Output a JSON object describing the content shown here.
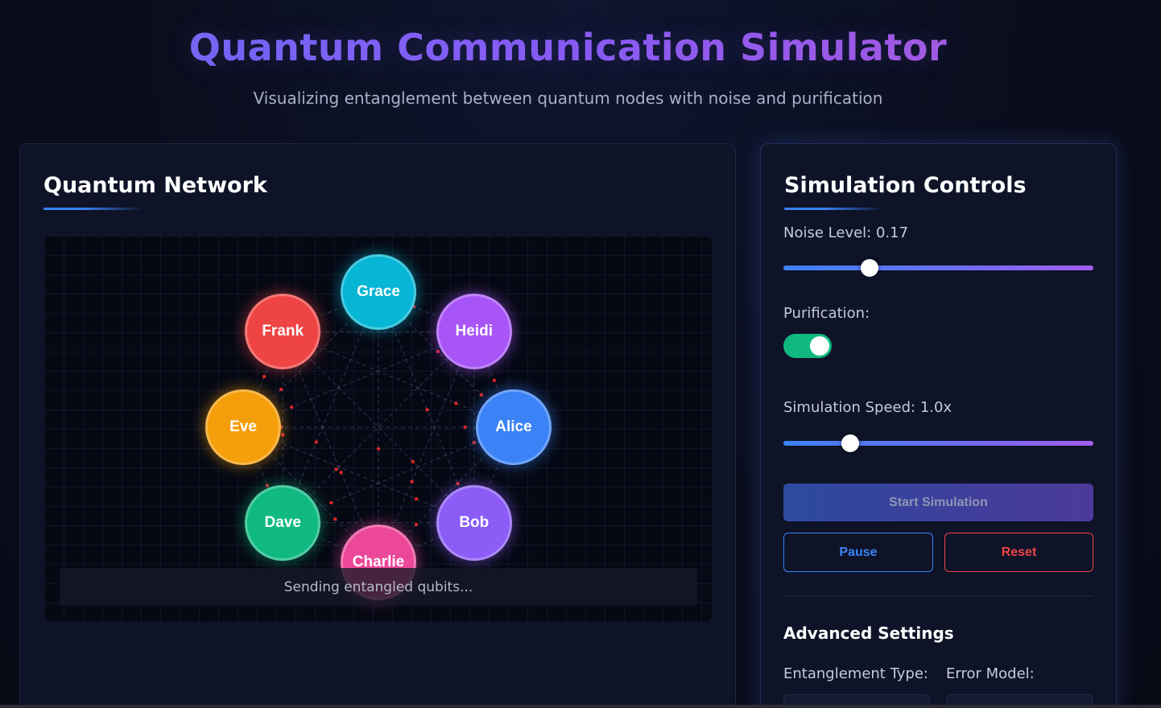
{
  "header": {
    "title": "Quantum Communication Simulator",
    "subtitle": "Visualizing entanglement between quantum nodes with noise and purification"
  },
  "network": {
    "title": "Quantum Network",
    "status": "Sending entangled qubits...",
    "nodes": [
      {
        "label": "Grace",
        "color": "#06b6d4"
      },
      {
        "label": "Heidi",
        "color": "#a855f7"
      },
      {
        "label": "Alice",
        "color": "#3b82f6"
      },
      {
        "label": "Bob",
        "color": "#8b5cf6"
      },
      {
        "label": "Charlie",
        "color": "#ec4899"
      },
      {
        "label": "Dave",
        "color": "#10b981"
      },
      {
        "label": "Eve",
        "color": "#f59e0b"
      },
      {
        "label": "Frank",
        "color": "#ef4444"
      }
    ]
  },
  "controls": {
    "title": "Simulation Controls",
    "noise_label": "Noise Level: 0.17",
    "noise_value": 0.17,
    "purification_label": "Purification:",
    "purification_on": true,
    "speed_label": "Simulation Speed: 1.0x",
    "speed_value": 1.0,
    "start_label": "Start Simulation",
    "pause_label": "Pause",
    "reset_label": "Reset",
    "advanced_title": "Advanced Settings",
    "entanglement_type_label": "Entanglement Type:",
    "error_model_label": "Error Model:"
  },
  "colors": {
    "accent_blue": "#3b82f6",
    "accent_purple": "#8b5cf6",
    "toggle_on": "#10b981",
    "danger": "#ef4444",
    "link_red": "#dc2626"
  }
}
